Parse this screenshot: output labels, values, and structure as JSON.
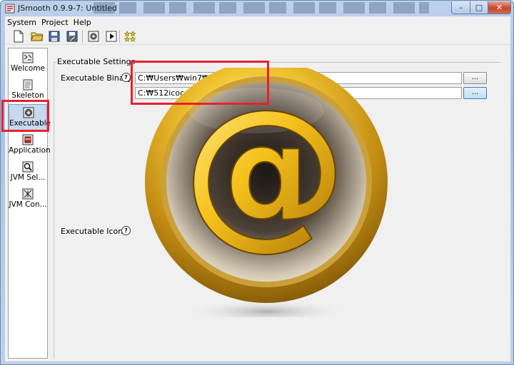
{
  "window": {
    "title": "JSmooth 0.9.9-7: Untitled"
  },
  "window_controls": {
    "minimize": "–",
    "maximize": "□",
    "close": "✕"
  },
  "menu": {
    "items": [
      "System",
      "Project",
      "Help"
    ]
  },
  "toolbar": {
    "buttons": [
      {
        "name": "new-project",
        "icon": "new-document-icon"
      },
      {
        "name": "open-project",
        "icon": "open-folder-icon"
      },
      {
        "name": "save-project",
        "icon": "save-disk-icon"
      },
      {
        "name": "save-as-project",
        "icon": "save-as-disk-icon"
      },
      {
        "name": "compile",
        "icon": "gear-compile-icon"
      },
      {
        "name": "run",
        "icon": "run-play-icon"
      },
      {
        "name": "about",
        "icon": "stars-icon"
      }
    ]
  },
  "sidebar": {
    "items": [
      {
        "label": "Welcome",
        "icon": "welcome-icon"
      },
      {
        "label": "Skeleton",
        "icon": "skeleton-icon"
      },
      {
        "label": "Executable",
        "icon": "executable-icon",
        "active": true
      },
      {
        "label": "Application",
        "icon": "application-icon"
      },
      {
        "label": "JVM Sel...",
        "icon": "jvm-selection-icon"
      },
      {
        "label": "JVM Con...",
        "icon": "jvm-configuration-icon"
      }
    ]
  },
  "settings": {
    "group_title": "Executable Settings",
    "binary": {
      "label": "Executable Binary",
      "value": "C:₩Users₩win7₩Desktop₩test.exe",
      "button": "..."
    },
    "icon": {
      "label": "Executable Icon",
      "value": "C:₩512icoco.png",
      "button": "...",
      "preview_glyph": "@"
    }
  },
  "annotation_color": "#e8202c"
}
